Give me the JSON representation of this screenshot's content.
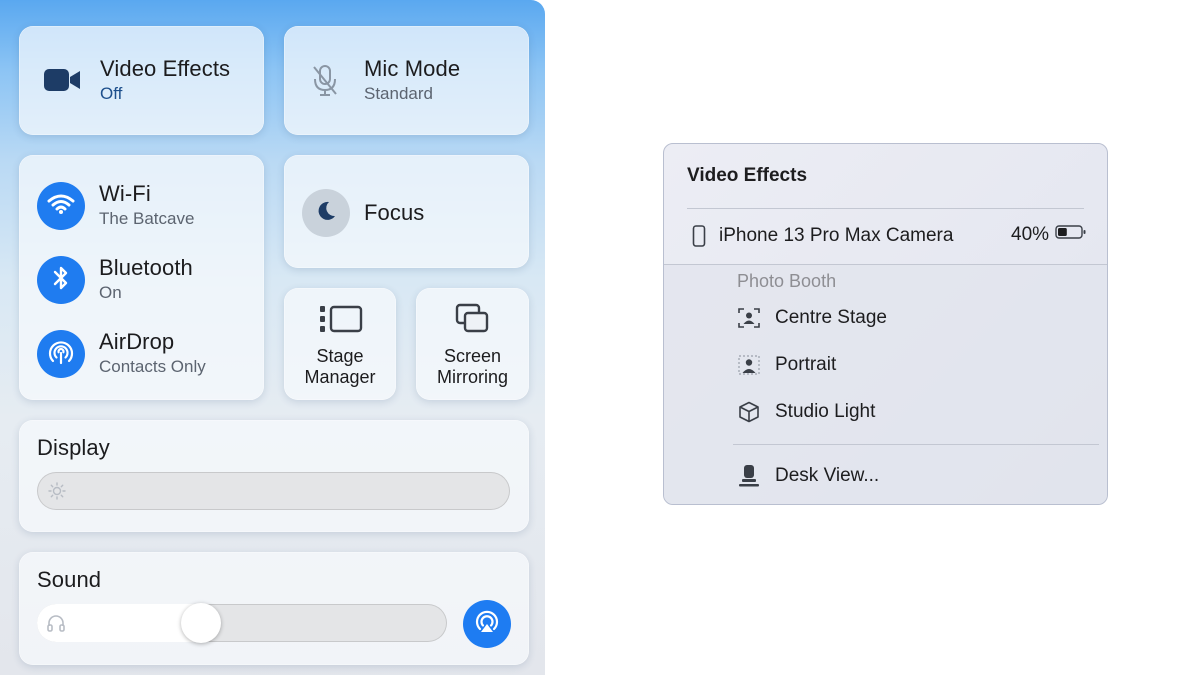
{
  "control_center": {
    "video_effects": {
      "title": "Video Effects",
      "subtitle": "Off",
      "icon": "video-camera-icon"
    },
    "mic_mode": {
      "title": "Mic Mode",
      "subtitle": "Standard",
      "icon": "microphone-icon"
    },
    "network": {
      "wifi": {
        "title": "Wi-Fi",
        "subtitle": "The Batcave",
        "icon": "wifi-icon"
      },
      "bluetooth": {
        "title": "Bluetooth",
        "subtitle": "On",
        "icon": "bluetooth-icon"
      },
      "airdrop": {
        "title": "AirDrop",
        "subtitle": "Contacts Only",
        "icon": "airdrop-icon"
      }
    },
    "focus": {
      "title": "Focus",
      "icon": "moon-icon"
    },
    "stage_manager": {
      "line1": "Stage",
      "line2": "Manager",
      "icon": "stage-manager-icon"
    },
    "screen_mirroring": {
      "line1": "Screen",
      "line2": "Mirroring",
      "icon": "screen-mirroring-icon"
    },
    "display": {
      "title": "Display",
      "brightness": 0.0,
      "icon": "sun-icon"
    },
    "sound": {
      "title": "Sound",
      "volume": 0.39,
      "icon": "headphones-icon",
      "output_icon": "airplay-icon"
    },
    "accent_color": "#1f7cf0"
  },
  "video_effects_menu": {
    "title": "Video Effects",
    "device": {
      "name": "iPhone 13 Pro Max Camera",
      "battery": "40%",
      "icon": "iphone-icon",
      "battery_level": 0.4
    },
    "section_label": "Photo Booth",
    "items": [
      {
        "label": "Centre Stage",
        "icon": "centre-stage-icon"
      },
      {
        "label": "Portrait",
        "icon": "portrait-icon"
      },
      {
        "label": "Studio Light",
        "icon": "cube-icon"
      }
    ],
    "desk_view": {
      "label": "Desk View...",
      "icon": "desk-view-icon"
    }
  }
}
